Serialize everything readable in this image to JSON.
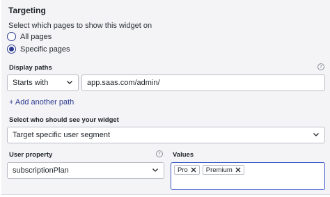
{
  "targeting": {
    "title": "Targeting",
    "pages_prompt": "Select which pages to show this widget on",
    "page_options": [
      {
        "label": "All pages",
        "selected": false
      },
      {
        "label": "Specific pages",
        "selected": true
      }
    ]
  },
  "display_paths": {
    "label": "Display paths",
    "match_select": "Starts with",
    "path_value": "app.saas.com/admin/",
    "add_link": "+ Add another path"
  },
  "audience": {
    "label": "Select who should see your widget",
    "select_value": "Target specific user segment"
  },
  "user_property": {
    "label": "User property",
    "select_value": "subscriptionPlan"
  },
  "values": {
    "label": "Values",
    "chips": [
      "Pro",
      "Premium"
    ]
  },
  "colors": {
    "accent": "#2b3a8f",
    "focus_border": "#3a56c7",
    "panel_bg": "#f4f4f6"
  },
  "icons": {
    "help": "question-circle-icon",
    "dropdown": "chevron-down-icon",
    "remove": "close-icon"
  }
}
